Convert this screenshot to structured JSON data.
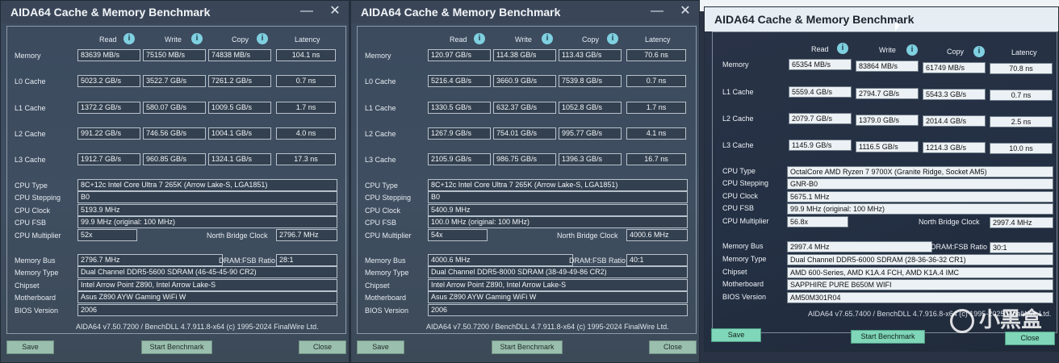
{
  "colors": {
    "window_bg": "#3f4e60",
    "button_bg": "#9bbfae",
    "info_icon": "#7fd0e0",
    "field_bg_photo": "#ecf1f5"
  },
  "windows": [
    {
      "title": "AIDA64 Cache & Memory Benchmark",
      "headers": {
        "read": "Read",
        "write": "Write",
        "copy": "Copy",
        "latency": "Latency"
      },
      "bench": [
        {
          "label": "Memory",
          "read": "83639 MB/s",
          "write": "75150 MB/s",
          "copy": "74838 MB/s",
          "latency": "104.1 ns"
        },
        {
          "label": "L0 Cache",
          "read": "5023.2 GB/s",
          "write": "3522.7 GB/s",
          "copy": "7261.2 GB/s",
          "latency": "0.7 ns"
        },
        {
          "label": "L1 Cache",
          "read": "1372.2 GB/s",
          "write": "580.07 GB/s",
          "copy": "1009.5 GB/s",
          "latency": "1.7 ns"
        },
        {
          "label": "L2 Cache",
          "read": "991.22 GB/s",
          "write": "746.56 GB/s",
          "copy": "1004.1 GB/s",
          "latency": "4.0 ns"
        },
        {
          "label": "L3 Cache",
          "read": "1912.7 GB/s",
          "write": "960.85 GB/s",
          "copy": "1324.1 GB/s",
          "latency": "17.3 ns"
        }
      ],
      "info": {
        "cpu_type_label": "CPU Type",
        "cpu_type": "8C+12c Intel Core Ultra 7 265K  (Arrow Lake-S, LGA1851)",
        "cpu_stepping_label": "CPU Stepping",
        "cpu_stepping": "B0",
        "cpu_clock_label": "CPU Clock",
        "cpu_clock": "5193.9 MHz",
        "cpu_fsb_label": "CPU FSB",
        "cpu_fsb": "99.9 MHz  (original: 100 MHz)",
        "cpu_multiplier_label": "CPU Multiplier",
        "cpu_multiplier": "52x",
        "nb_clock_label": "North Bridge Clock",
        "nb_clock": "2796.7 MHz",
        "memory_bus_label": "Memory Bus",
        "memory_bus": "2796.7 MHz",
        "dram_ratio_label": "DRAM:FSB Ratio",
        "dram_ratio": "28:1",
        "memory_type_label": "Memory Type",
        "memory_type": "Dual Channel DDR5-5600 SDRAM  (46-45-45-90 CR2)",
        "chipset_label": "Chipset",
        "chipset": "Intel Arrow Point Z890, Intel Arrow Lake-S",
        "motherboard_label": "Motherboard",
        "motherboard": "Asus Z890 AYW Gaming WiFi W",
        "bios_label": "BIOS Version",
        "bios": "2006"
      },
      "footer": "AIDA64 v7.50.7200 / BenchDLL 4.7.911.8-x64  (c) 1995-2024 FinalWire Ltd.",
      "buttons": {
        "save": "Save",
        "start": "Start Benchmark",
        "close": "Close"
      }
    },
    {
      "title": "AIDA64 Cache & Memory Benchmark",
      "headers": {
        "read": "Read",
        "write": "Write",
        "copy": "Copy",
        "latency": "Latency"
      },
      "bench": [
        {
          "label": "Memory",
          "read": "120.97 GB/s",
          "write": "114.38 GB/s",
          "copy": "113.43 GB/s",
          "latency": "70.6 ns"
        },
        {
          "label": "L0 Cache",
          "read": "5216.4 GB/s",
          "write": "3660.9 GB/s",
          "copy": "7539.8 GB/s",
          "latency": "0.7 ns"
        },
        {
          "label": "L1 Cache",
          "read": "1330.5 GB/s",
          "write": "632.37 GB/s",
          "copy": "1052.8 GB/s",
          "latency": "1.7 ns"
        },
        {
          "label": "L2 Cache",
          "read": "1267.9 GB/s",
          "write": "754.01 GB/s",
          "copy": "995.77 GB/s",
          "latency": "4.1 ns"
        },
        {
          "label": "L3 Cache",
          "read": "2105.9 GB/s",
          "write": "986.75 GB/s",
          "copy": "1396.3 GB/s",
          "latency": "16.7 ns"
        }
      ],
      "info": {
        "cpu_type_label": "CPU Type",
        "cpu_type": "8C+12c Intel Core Ultra 7 265K  (Arrow Lake-S, LGA1851)",
        "cpu_stepping_label": "CPU Stepping",
        "cpu_stepping": "B0",
        "cpu_clock_label": "CPU Clock",
        "cpu_clock": "5400.9 MHz",
        "cpu_fsb_label": "CPU FSB",
        "cpu_fsb": "100.0 MHz  (original: 100 MHz)",
        "cpu_multiplier_label": "CPU Multiplier",
        "cpu_multiplier": "54x",
        "nb_clock_label": "North Bridge Clock",
        "nb_clock": "4000.6 MHz",
        "memory_bus_label": "Memory Bus",
        "memory_bus": "4000.6 MHz",
        "dram_ratio_label": "DRAM:FSB Ratio",
        "dram_ratio": "40:1",
        "memory_type_label": "Memory Type",
        "memory_type": "Dual Channel DDR5-8000 SDRAM  (38-49-49-86 CR2)",
        "chipset_label": "Chipset",
        "chipset": "Intel Arrow Point Z890, Intel Arrow Lake-S",
        "motherboard_label": "Motherboard",
        "motherboard": "Asus Z890 AYW Gaming WiFi W",
        "bios_label": "BIOS Version",
        "bios": "2006"
      },
      "footer": "AIDA64 v7.50.7200 / BenchDLL 4.7.911.8-x64  (c) 1995-2024 FinalWire Ltd.",
      "buttons": {
        "save": "Save",
        "start": "Start Benchmark",
        "close": "Close"
      }
    },
    {
      "title": "AIDA64 Cache & Memory Benchmark",
      "headers": {
        "read": "Read",
        "write": "Write",
        "copy": "Copy",
        "latency": "Latency"
      },
      "bench": [
        {
          "label": "Memory",
          "read": "65354 MB/s",
          "write": "83864 MB/s",
          "copy": "61749 MB/s",
          "latency": "70.8 ns"
        },
        {
          "label": "L1 Cache",
          "read": "5559.4 GB/s",
          "write": "2794.7 GB/s",
          "copy": "5543.3 GB/s",
          "latency": "0.7 ns"
        },
        {
          "label": "L2 Cache",
          "read": "2079.7 GB/s",
          "write": "1379.0 GB/s",
          "copy": "2014.4 GB/s",
          "latency": "2.5 ns"
        },
        {
          "label": "L3 Cache",
          "read": "1145.9 GB/s",
          "write": "1116.5 GB/s",
          "copy": "1214.3 GB/s",
          "latency": "10.0 ns"
        }
      ],
      "info": {
        "cpu_type_label": "CPU Type",
        "cpu_type": "OctalCore AMD Ryzen 7 9700X  (Granite Ridge, Socket AM5)",
        "cpu_stepping_label": "CPU Stepping",
        "cpu_stepping": "GNR-B0",
        "cpu_clock_label": "CPU Clock",
        "cpu_clock": "5675.1 MHz",
        "cpu_fsb_label": "CPU FSB",
        "cpu_fsb": "99.9 MHz  (original: 100 MHz)",
        "cpu_multiplier_label": "CPU Multiplier",
        "cpu_multiplier": "56.8x",
        "nb_clock_label": "North Bridge Clock",
        "nb_clock": "2997.4 MHz",
        "memory_bus_label": "Memory Bus",
        "memory_bus": "2997.4 MHz",
        "dram_ratio_label": "DRAM:FSB Ratio",
        "dram_ratio": "30:1",
        "memory_type_label": "Memory Type",
        "memory_type": "Dual Channel DDR5-6000 SDRAM  (28-36-36-32 CR1)",
        "chipset_label": "Chipset",
        "chipset": "AMD 600-Series, AMD K1A.4 FCH, AMD K1A.4 IMC",
        "motherboard_label": "Motherboard",
        "motherboard": "SAPPHIRE PURE B650M WIFI",
        "bios_label": "BIOS Version",
        "bios": "AM50M301R04"
      },
      "footer": "AIDA64 v7.65.7400 / BenchDLL 4.7.916.8-x64  (c) 1995-2025 FinalWire Ltd.",
      "buttons": {
        "save": "Save",
        "start": "Start Benchmark",
        "close": "Close"
      },
      "watermark": "小黑盒"
    }
  ]
}
